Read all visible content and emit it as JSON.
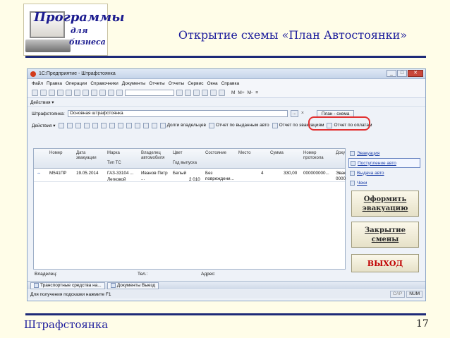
{
  "logo": {
    "line1": "Программы",
    "line2": "для",
    "line3": "бизнеса"
  },
  "slide": {
    "title": "Открытие схемы «План Автостоянки»",
    "footer": "Штрафстоянка",
    "page_number": "17"
  },
  "window": {
    "title": "1С:Предприятие - Штрафстоянка",
    "minimize": "_",
    "maximize": "□",
    "close": "✕"
  },
  "menu": [
    "Файл",
    "Правка",
    "Операции",
    "Справочники",
    "Документы",
    "Отчеты",
    "Отчеты",
    "Сервис",
    "Окна",
    "Справка"
  ],
  "toolbar_right": [
    "M",
    "M+",
    "M-",
    "≡"
  ],
  "actions_menu": "Действия ▾",
  "lot": {
    "label": "Штрафстоянка:",
    "value": "Основная штрафстоянка",
    "dots": "...",
    "clear": "×",
    "plan_button": "План - схема"
  },
  "actions2": {
    "actions": "Действия ▾",
    "debtors": "Долги владельцев",
    "report_issued": "Отчет по выданным авто",
    "report_evac": "Отчет по эвакуациям",
    "report_payments": "Отчет по оплатам"
  },
  "columns": {
    "number": "Номер",
    "date": "Дата эвакуации",
    "brand": "Марка",
    "vehicle_type": "Тип ТС",
    "owner": "Владелец автомобиля",
    "color": "Цвет",
    "year": "Год выпуска",
    "state": "Состояние",
    "place": "Место",
    "amount": "Сумма",
    "protocol": "Номер протокола",
    "doc": "Доку"
  },
  "rows": [
    {
      "number": "М541ПР",
      "date": "19.05.2014",
      "brand": "ГАЗ-33104 ...",
      "vehicle_type": "Легковой",
      "owner": "Иванов Петр ...",
      "color": "Белый",
      "year": "2 010",
      "state": "Без повреждени...",
      "place": "4",
      "amount": "330,00",
      "protocol": "000000000...",
      "doc": "Эвак 0000"
    }
  ],
  "side_links": [
    "Эвакуация",
    "Поступление авто",
    "Выдача авто",
    "Чеки"
  ],
  "side_buttons": {
    "evacuation": "Оформить эвакуацию",
    "close_shift": "Закрытие смены",
    "exit": "ВЫХОД"
  },
  "bottom_fields": {
    "owner": "Владелец:",
    "phone": "Тел.:",
    "address": "Адрес:"
  },
  "taskbar": [
    "Транспортные средства на...",
    "Документы Выезд"
  ],
  "status": {
    "hint": "Для получения подсказки нажмите F1",
    "caps": "CAP",
    "num": "NUM"
  }
}
